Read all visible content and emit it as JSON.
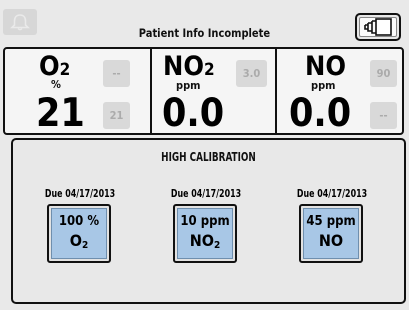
{
  "header": {
    "title": "Patient Info Incomplete",
    "alarm_icon": "bell-icon",
    "window_icon": "stacked-windows-icon"
  },
  "gases": [
    {
      "name": "O",
      "sub": "2",
      "unit": "%",
      "value": "21",
      "setting_top": "--",
      "setting_bottom": "21"
    },
    {
      "name": "NO",
      "sub": "2",
      "unit": "ppm",
      "value": "0.0",
      "setting_top": "3.0"
    },
    {
      "name": "NO",
      "sub": "",
      "unit": "ppm",
      "value": "0.0",
      "setting_top": "90",
      "setting_bottom": "--"
    }
  ],
  "calibration": {
    "title": "HIGH CALIBRATION",
    "items": [
      {
        "due": "Due 04/17/2013",
        "value": "100 %",
        "gas": "O",
        "gas_sub": "2"
      },
      {
        "due": "Due 04/17/2013",
        "value": "10 ppm",
        "gas": "NO",
        "gas_sub": "2"
      },
      {
        "due": "Due 04/17/2013",
        "value": "45 ppm",
        "gas": "NO",
        "gas_sub": ""
      }
    ]
  },
  "colors": {
    "button_fill": "#a8c7e6",
    "disabled_box": "#d9d9d9",
    "disabled_text": "#ababab"
  }
}
